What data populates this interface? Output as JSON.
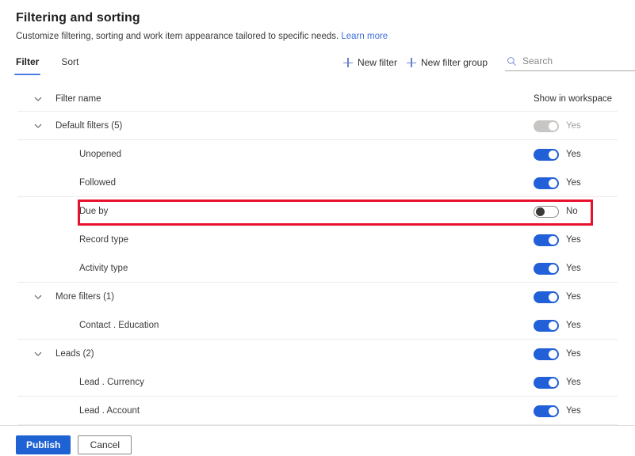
{
  "header": {
    "title": "Filtering and sorting",
    "subtitle": "Customize filtering, sorting and work item appearance tailored to specific needs.",
    "learn_more": "Learn more"
  },
  "tabs": [
    {
      "label": "Filter",
      "active": true
    },
    {
      "label": "Sort",
      "active": false
    }
  ],
  "commands": {
    "new_filter": "New filter",
    "new_filter_group": "New filter group"
  },
  "search": {
    "placeholder": "Search",
    "value": "",
    "icon": "search-icon"
  },
  "table": {
    "columns": {
      "name": "Filter name",
      "show_in_workspace": "Show in workspace"
    },
    "rows": [
      {
        "label": "Default filters (5)",
        "indent": 0,
        "expandable": true,
        "toggle": "disabled",
        "toggle_label": "Yes",
        "highlighted": false
      },
      {
        "label": "Unopened",
        "indent": 1,
        "expandable": false,
        "toggle": "on",
        "toggle_label": "Yes",
        "highlighted": false
      },
      {
        "label": "Followed",
        "indent": 1,
        "expandable": false,
        "toggle": "on",
        "toggle_label": "Yes",
        "highlighted": false
      },
      {
        "label": "Due by",
        "indent": 1,
        "expandable": false,
        "toggle": "off",
        "toggle_label": "No",
        "highlighted": true
      },
      {
        "label": "Record type",
        "indent": 1,
        "expandable": false,
        "toggle": "on",
        "toggle_label": "Yes",
        "highlighted": false
      },
      {
        "label": "Activity type",
        "indent": 1,
        "expandable": false,
        "toggle": "on",
        "toggle_label": "Yes",
        "highlighted": false
      },
      {
        "label": "More filters (1)",
        "indent": 0,
        "expandable": true,
        "toggle": "on",
        "toggle_label": "Yes",
        "highlighted": false
      },
      {
        "label": "Contact . Education",
        "indent": 1,
        "expandable": false,
        "toggle": "on",
        "toggle_label": "Yes",
        "highlighted": false
      },
      {
        "label": "Leads (2)",
        "indent": 0,
        "expandable": true,
        "toggle": "on",
        "toggle_label": "Yes",
        "highlighted": false
      },
      {
        "label": "Lead . Currency",
        "indent": 1,
        "expandable": false,
        "toggle": "on",
        "toggle_label": "Yes",
        "highlighted": false
      },
      {
        "label": "Lead . Account",
        "indent": 1,
        "expandable": false,
        "toggle": "on",
        "toggle_label": "Yes",
        "highlighted": false
      }
    ]
  },
  "footer": {
    "publish": "Publish",
    "cancel": "Cancel"
  },
  "colors": {
    "accent_blue": "#1f62d3",
    "toggle_on": "#2160d8",
    "tab_underline": "#4a7ce8",
    "link": "#3f6fd8",
    "highlight_red": "#e8112d",
    "toggle_disabled": "#c8c6c4"
  }
}
